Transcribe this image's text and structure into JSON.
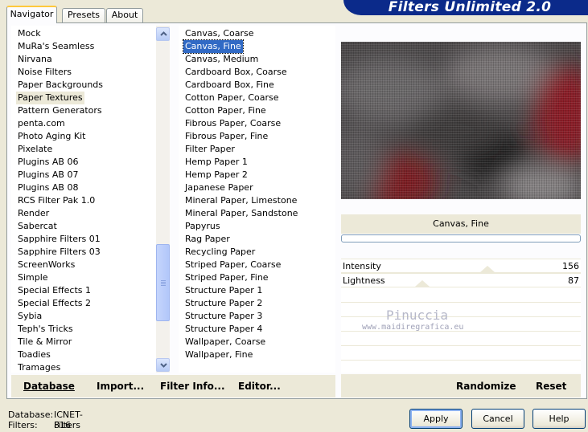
{
  "window": {
    "banner_title": "Filters Unlimited 2.0"
  },
  "tabs": [
    {
      "label": "Navigator",
      "active": true
    },
    {
      "label": "Presets",
      "active": false
    },
    {
      "label": "About",
      "active": false
    }
  ],
  "categories": {
    "items": [
      "Mock",
      "MuRa's Seamless",
      "Nirvana",
      "Noise Filters",
      "Paper Backgrounds",
      "Paper Textures",
      "Pattern Generators",
      "penta.com",
      "Photo Aging Kit",
      "Pixelate",
      "Plugins AB 06",
      "Plugins AB 07",
      "Plugins AB 08",
      "RCS Filter Pak 1.0",
      "Render",
      "Sabercat",
      "Sapphire Filters 01",
      "Sapphire Filters 03",
      "ScreenWorks",
      "Simple",
      "Special Effects 1",
      "Special Effects 2",
      "Sybia",
      "Teph's Tricks",
      "Tile & Mirror",
      "Toadies",
      "Tramages"
    ],
    "selected": "Paper Textures"
  },
  "filters": {
    "items": [
      "Canvas, Coarse",
      "Canvas, Fine",
      "Canvas, Medium",
      "Cardboard Box, Coarse",
      "Cardboard Box, Fine",
      "Cotton Paper, Coarse",
      "Cotton Paper, Fine",
      "Fibrous Paper, Coarse",
      "Fibrous Paper, Fine",
      "Filter Paper",
      "Hemp Paper 1",
      "Hemp Paper 2",
      "Japanese Paper",
      "Mineral Paper, Limestone",
      "Mineral Paper, Sandstone",
      "Papyrus",
      "Rag Paper",
      "Recycling Paper",
      "Striped Paper, Coarse",
      "Striped Paper, Fine",
      "Structure Paper 1",
      "Structure Paper 2",
      "Structure Paper 3",
      "Structure Paper 4",
      "Wallpaper, Coarse",
      "Wallpaper, Fine"
    ],
    "selected": "Canvas, Fine"
  },
  "preview": {
    "filter_name": "Canvas, Fine"
  },
  "params": [
    {
      "label": "Intensity",
      "value": "156",
      "fraction": 0.61
    },
    {
      "label": "Lightness",
      "value": "87",
      "fraction": 0.34
    }
  ],
  "left_buttons": {
    "database": "Database",
    "import": "Import...",
    "filter_info": "Filter Info...",
    "editor": "Editor..."
  },
  "right_buttons": {
    "randomize": "Randomize",
    "reset": "Reset"
  },
  "status": {
    "database_label": "Database:",
    "database_value": "ICNET-Filters",
    "filters_label": "Filters:",
    "filters_value": "816"
  },
  "dialog_buttons": {
    "apply": "Apply",
    "cancel": "Cancel",
    "help": "Help"
  },
  "watermark": {
    "name": "Pinuccia",
    "site": "www.maidiregrafica.eu"
  },
  "colors": {
    "selection": "#316ac5",
    "banner": "#0b2a8a",
    "face": "#ece9d8"
  }
}
